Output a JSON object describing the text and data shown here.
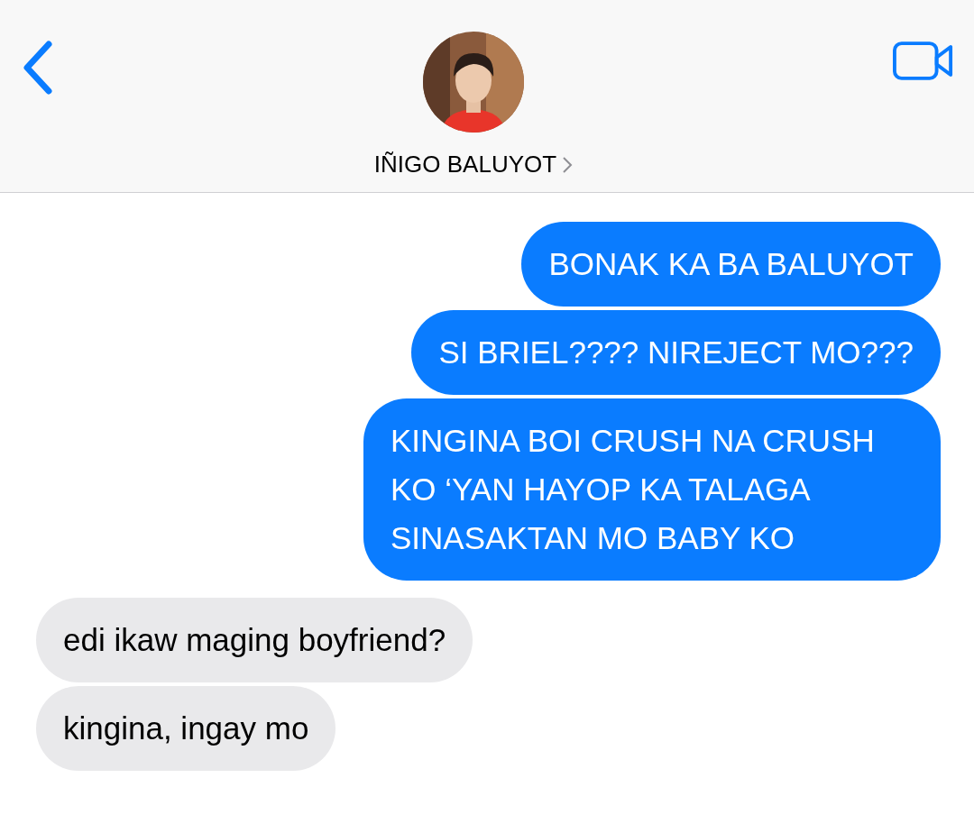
{
  "header": {
    "contact_name": "IÑIGO BALUYOT"
  },
  "messages": [
    {
      "text": "BONAK KA BA BALUYOT",
      "kind": "sent"
    },
    {
      "text": "SI BRIEL???? NIREJECT MO???",
      "kind": "sent"
    },
    {
      "text": "KINGINA BOI CRUSH NA CRUSH KO ‘YAN HAYOP KA TALAGA SINASAKTAN MO BABY KO",
      "kind": "sent"
    },
    {
      "text": "edi ikaw maging boyfriend?",
      "kind": "received"
    },
    {
      "text": "kingina, ingay mo",
      "kind": "received"
    }
  ]
}
